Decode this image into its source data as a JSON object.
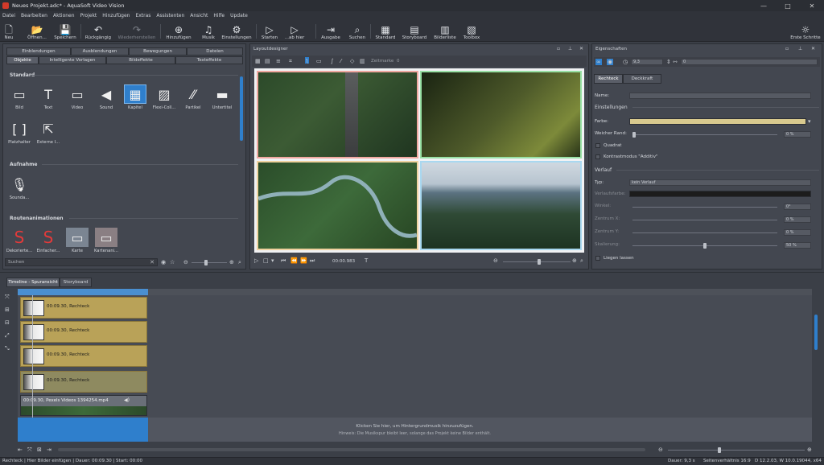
{
  "window": {
    "title": "Neues Projekt.adc* - AquaSoft Video Vision",
    "controls": [
      "—",
      "□",
      "✕"
    ]
  },
  "menu": [
    "Datei",
    "Bearbeiten",
    "Aktionen",
    "Projekt",
    "Hinzufügen",
    "Extras",
    "Assistenten",
    "Ansicht",
    "Hilfe",
    "Update"
  ],
  "toolbar": {
    "buttons": [
      {
        "label": "Neu",
        "icon": "new-file-icon",
        "glyph": "🗋"
      },
      {
        "label": "Öffnen...",
        "icon": "open-folder-icon",
        "glyph": "📂"
      },
      {
        "label": "Speichern",
        "icon": "save-icon",
        "glyph": "💾"
      },
      {
        "label": "Rückgängig",
        "icon": "undo-icon",
        "glyph": "↶"
      },
      {
        "label": "Wiederherstellen",
        "icon": "redo-icon",
        "glyph": "↷"
      },
      {
        "label": "Hinzufügen",
        "icon": "add-icon",
        "glyph": "⊕"
      },
      {
        "label": "Musik",
        "icon": "music-icon",
        "glyph": "♫"
      },
      {
        "label": "Einstellungen",
        "icon": "sliders-icon",
        "glyph": "⚙"
      },
      {
        "label": "Starten",
        "icon": "play-icon",
        "glyph": "▷"
      },
      {
        "label": "...ab hier",
        "icon": "play-from-here-icon",
        "glyph": "▷"
      },
      {
        "label": "Ausgabe",
        "icon": "export-icon",
        "glyph": "⇥"
      },
      {
        "label": "Suchen",
        "icon": "search-icon",
        "glyph": "⌕"
      },
      {
        "label": "Standard",
        "icon": "layout-standard-icon",
        "glyph": "▦"
      },
      {
        "label": "Storyboard",
        "icon": "storyboard-icon",
        "glyph": "▤"
      },
      {
        "label": "Bilderliste",
        "icon": "image-list-icon",
        "glyph": "▥"
      },
      {
        "label": "Toolbox",
        "icon": "toolbox-icon",
        "glyph": "▧"
      },
      {
        "label": "Erste Schritte",
        "icon": "lightbulb-icon",
        "glyph": "☼"
      }
    ]
  },
  "toolbox": {
    "tabs_row1": [
      "Einblendungen",
      "Ausblendungen",
      "Bewegungen",
      "Dateien"
    ],
    "tabs_row2": [
      "Objekte",
      "Intelligente Vorlagen",
      "Bildeffekte",
      "Texteffekte"
    ],
    "sections": {
      "standard": "Standard",
      "aufnahme": "Aufnahme",
      "routen": "Routenanimationen"
    },
    "standard_items": [
      {
        "label": "Bild",
        "icon": "image-object-icon",
        "glyph": "▭"
      },
      {
        "label": "Text",
        "icon": "text-object-icon",
        "glyph": "T"
      },
      {
        "label": "Video",
        "icon": "video-object-icon",
        "glyph": "▭"
      },
      {
        "label": "Sound",
        "icon": "sound-object-icon",
        "glyph": "◀"
      },
      {
        "label": "Kapitel",
        "icon": "chapter-object-icon",
        "glyph": "▦"
      },
      {
        "label": "Flexi-Coll...",
        "icon": "flexi-collage-icon",
        "glyph": "▨"
      },
      {
        "label": "Partikel",
        "icon": "particle-icon",
        "glyph": "⁄⁄"
      },
      {
        "label": "Untertitel",
        "icon": "subtitle-icon",
        "glyph": "▬"
      },
      {
        "label": "Platzhalter",
        "icon": "placeholder-icon",
        "glyph": "[ ]"
      },
      {
        "label": "Externe I...",
        "icon": "external-import-icon",
        "glyph": "⇱"
      }
    ],
    "aufnahme_items": [
      {
        "label": "Sounda...",
        "icon": "microphone-icon",
        "glyph": "🎙"
      }
    ],
    "routen_items": [
      {
        "label": "Dekorierte...",
        "icon": "route-red-icon",
        "glyph": "S"
      },
      {
        "label": "Einfacher...",
        "icon": "route-simple-icon",
        "glyph": "S"
      },
      {
        "label": "Karte",
        "icon": "map-icon",
        "glyph": "▭"
      },
      {
        "label": "Kartenani...",
        "icon": "map-animation-icon",
        "glyph": "▭"
      }
    ],
    "search_placeholder": "Suchen"
  },
  "layout_designer": {
    "title": "Layoutdesigner",
    "zoom_label": "Zeitmarke",
    "zoom_value": "0",
    "time": "00:00.983",
    "images": [
      {
        "name": "forest-road-aerial",
        "colors": [
          "#2c4a2a",
          "#3c5b34",
          "#1f3520"
        ]
      },
      {
        "name": "forest-sunlight",
        "colors": [
          "#1a2412",
          "#4e5a2a",
          "#7d8a3a"
        ]
      },
      {
        "name": "winding-river-aerial",
        "colors": [
          "#2b4d2a",
          "#3d6a3a",
          "#274523"
        ]
      },
      {
        "name": "mountain-forest",
        "colors": [
          "#cfd8e0",
          "#5c7382",
          "#2f4a35"
        ]
      }
    ]
  },
  "properties": {
    "title": "Eigenschaften",
    "value_a": "9,3",
    "value_b": "0",
    "tabs": [
      "Rechteck",
      "Deckkraft"
    ],
    "name_label": "Name:",
    "settings_header": "Einstellungen",
    "color_label": "Farbe:",
    "soft_edge_label": "Weicher Rand:",
    "soft_edge_value": "0 %",
    "square_label": "Quadrat",
    "contrast_label": "Kontrastmodus \"Additiv\"",
    "gradient_header": "Verlauf",
    "type_label": "Typ:",
    "type_value": "kein Verlauf",
    "grad_color_label": "Verlaufsfarbe:",
    "stretch_label": "Winkel:",
    "stretch_value": "0°",
    "center_x_label": "Zentrum X:",
    "center_x_value": "0 %",
    "center_y_label": "Zentrum Y:",
    "center_y_value": "0 %",
    "hardness_label": "Skalierung:",
    "hardness_value": "50 %",
    "lying_label": "Liegen lassen",
    "colors": {
      "fill": "#d8c98e",
      "gradient": "#1c1c1c"
    }
  },
  "timeline": {
    "tabs": [
      "Timeline - Spuransicht",
      "Storyboard"
    ],
    "clips": [
      {
        "label": "00:09.30, Rechteck"
      },
      {
        "label": "00:09.30, Rechteck"
      },
      {
        "label": "00:09.30, Rechteck"
      },
      {
        "label": "00:09.30, Rechteck"
      }
    ],
    "video_clip": {
      "label": "00:09.30, Pexels Videos 1394254.mp4"
    },
    "music_hint_1": "Klicken Sie hier, um Hintergrundmusik hinzuzufügen.",
    "music_hint_2": "Hinweis: Die Musikspur bleibt leer, solange das Projekt keine Bilder enthält."
  },
  "statusbar": {
    "left": "Rechteck | Hier Bilder einfügen | Dauer: 00:09.30 | Start: 00:00",
    "duration": "Dauer: 9,3 s",
    "ratio": "Seitenverhältnis 16:9",
    "version": "D 12.2.03, W 10.0.19044, x64"
  }
}
